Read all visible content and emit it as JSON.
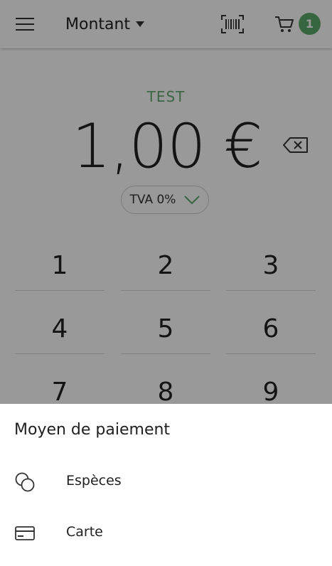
{
  "header": {
    "title": "Montant",
    "cart_count": "1",
    "accent_color": "#5ca86a"
  },
  "main": {
    "mode_label": "TEST",
    "amount": "1,00 €",
    "tva_label": "TVA 0%"
  },
  "keypad": {
    "keys": [
      "1",
      "2",
      "3",
      "4",
      "5",
      "6",
      "7",
      "8",
      "9"
    ]
  },
  "sheet": {
    "title": "Moyen de paiement",
    "options": [
      {
        "label": "Espèces",
        "icon": "coins-icon"
      },
      {
        "label": "Carte",
        "icon": "credit-card-icon"
      }
    ]
  }
}
